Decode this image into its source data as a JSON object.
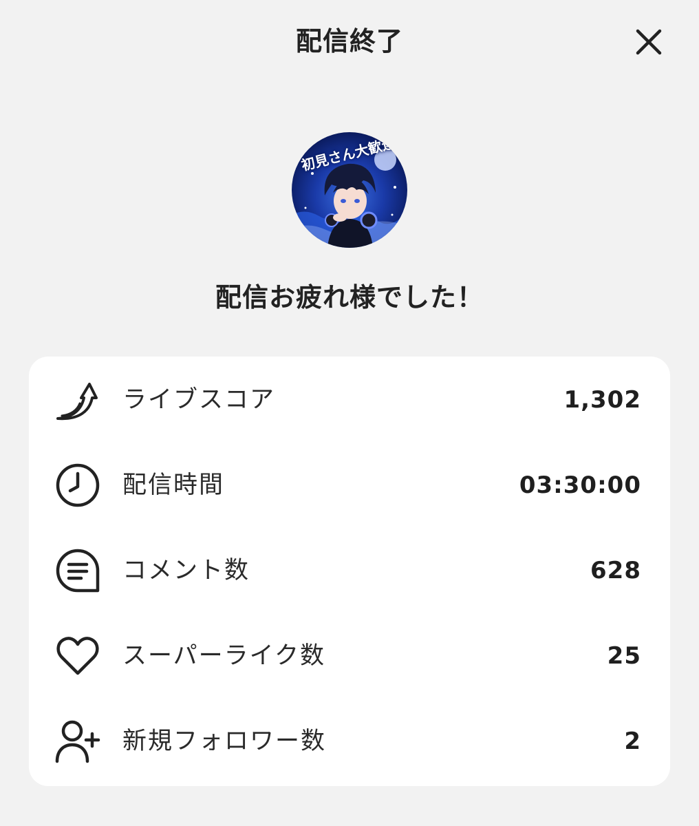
{
  "header": {
    "title": "配信終了",
    "close_icon": "close-icon"
  },
  "avatar": {
    "banner_text": "初見さん大歓迎"
  },
  "message": "配信お疲れ様でした！",
  "stats": [
    {
      "icon": "trend-arrow-icon",
      "label": "ライブスコア",
      "value": "1,302"
    },
    {
      "icon": "clock-icon",
      "label": "配信時間",
      "value": "03:30:00"
    },
    {
      "icon": "comment-icon",
      "label": "コメント数",
      "value": "628"
    },
    {
      "icon": "heart-icon",
      "label": "スーパーライク数",
      "value": "25"
    },
    {
      "icon": "add-user-icon",
      "label": "新規フォロワー数",
      "value": "2"
    }
  ],
  "colors": {
    "background": "#f2f2f2",
    "card": "#ffffff",
    "text": "#222222",
    "avatar_blue": "#1a3aa8"
  }
}
